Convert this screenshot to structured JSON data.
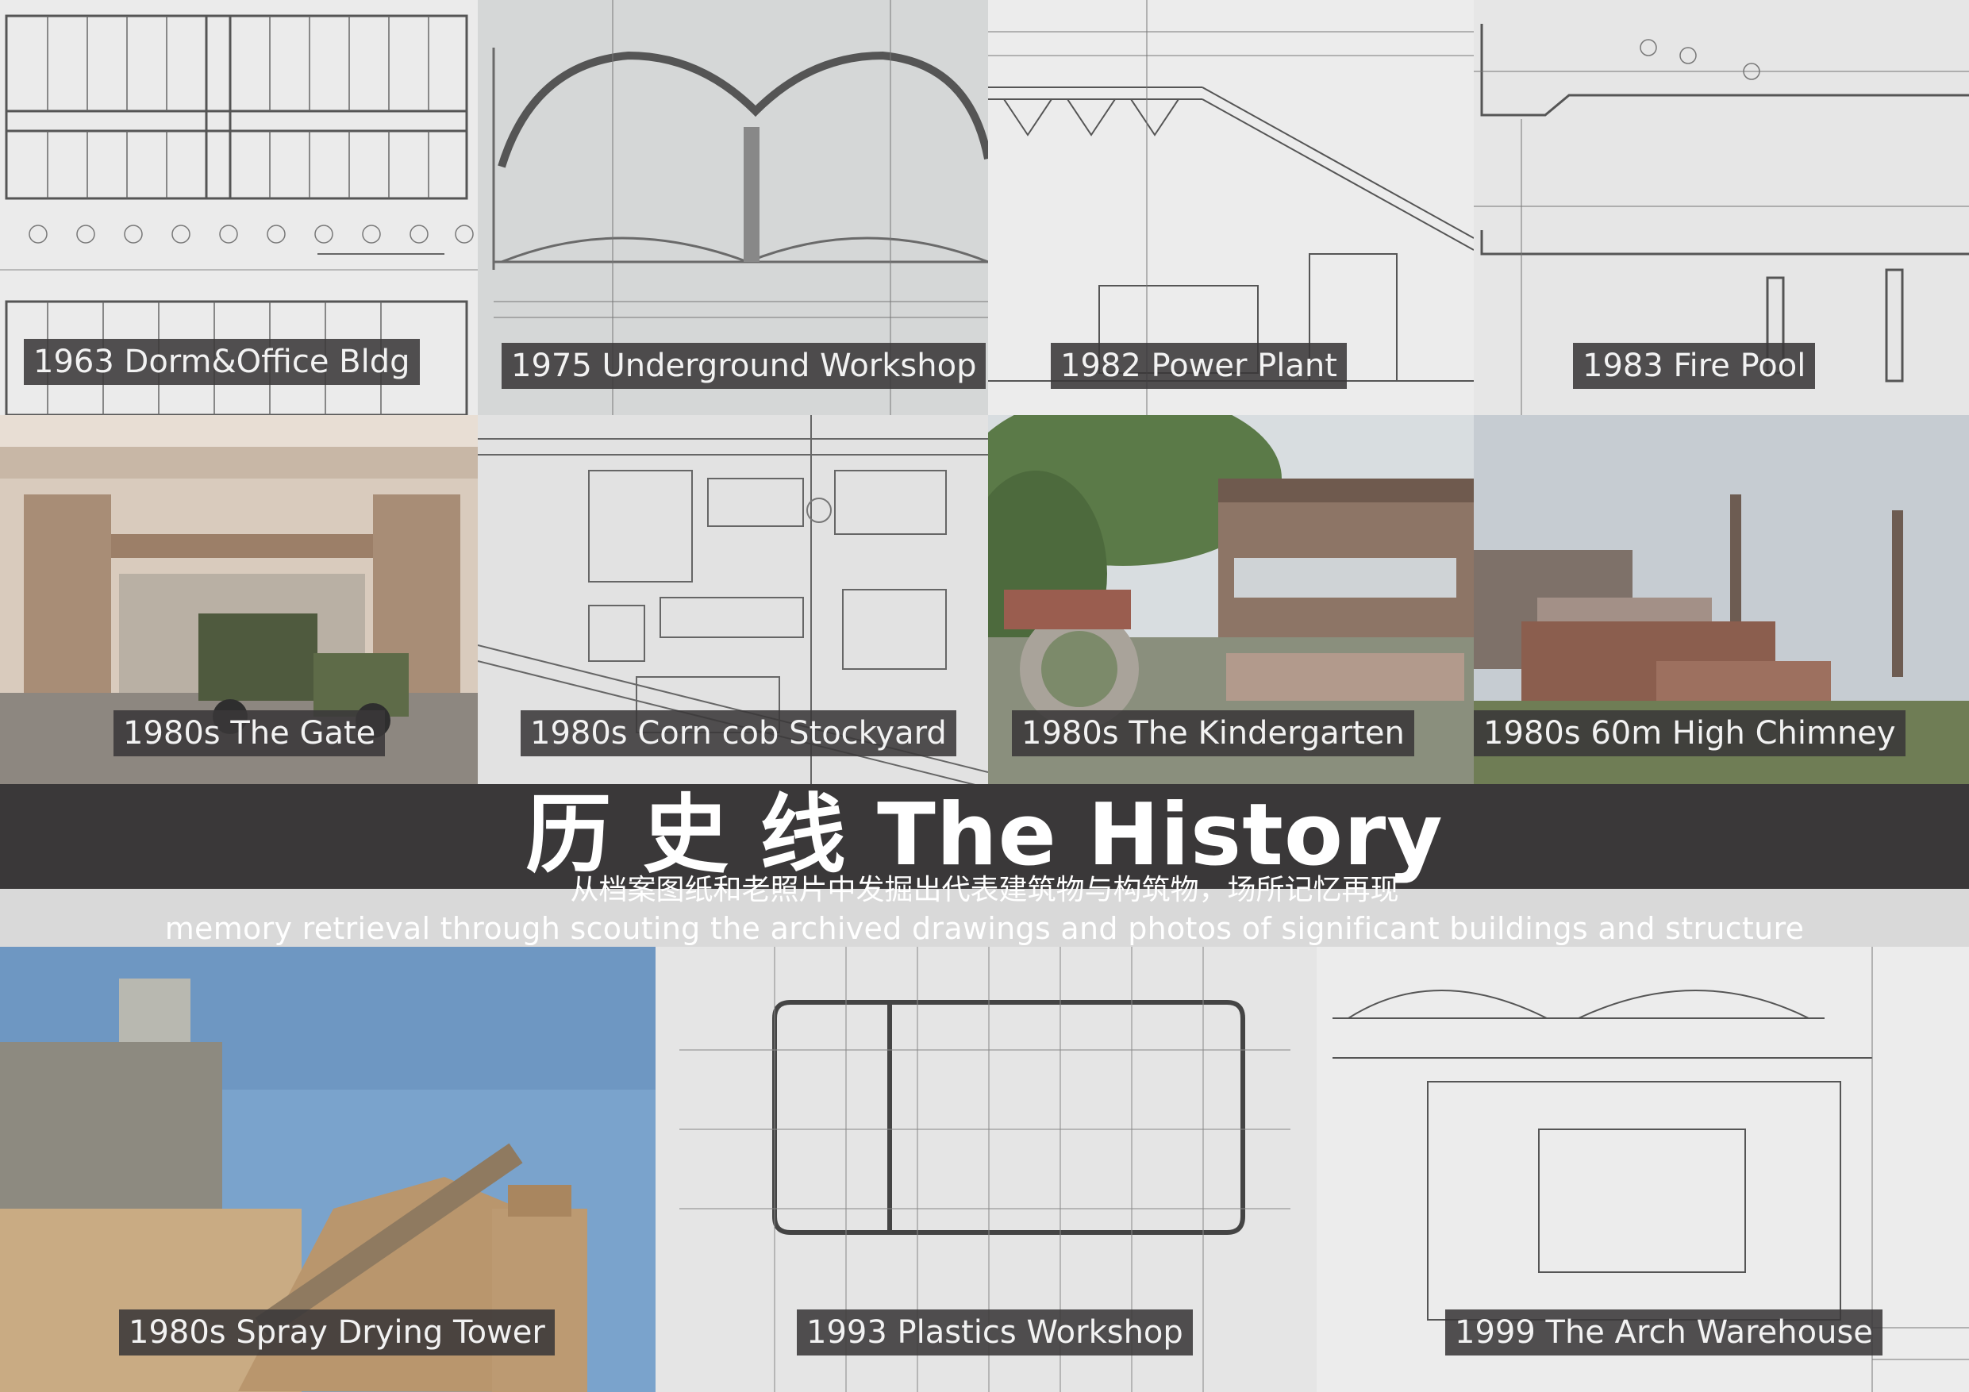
{
  "tiles": [
    {
      "caption": "1963 Dorm&Office Bldg"
    },
    {
      "caption": "1975 Underground Workshop"
    },
    {
      "caption": "1982 Power  Plant"
    },
    {
      "caption": "1983 Fire Pool"
    },
    {
      "caption": "1980s The Gate"
    },
    {
      "caption": "1980s Corn cob Stockyard"
    },
    {
      "caption": "1980s The Kindergarten"
    },
    {
      "caption": "1980s 60m High Chimney"
    },
    {
      "caption": "1980s Spray Drying Tower"
    },
    {
      "caption": "1993 Plastics Workshop"
    },
    {
      "caption": "1999 The Arch Warehouse"
    }
  ],
  "header": {
    "title": "历  史  线 The History",
    "subtitle_cn": "从档案图纸和老照片中发掘出代表建筑物与构筑物，场所记忆再现",
    "subtitle_en": "memory retrieval through scouting the archived drawings and photos of significant buildings and structure"
  },
  "colors": {
    "band": "#3a3839",
    "caption_bg": "#3a3839",
    "caption_text": "#f2f2f2",
    "drawing_paper": "#e9e9e9",
    "drawing_ink": "#4a4a4a",
    "sky": "#6f9bc7"
  }
}
